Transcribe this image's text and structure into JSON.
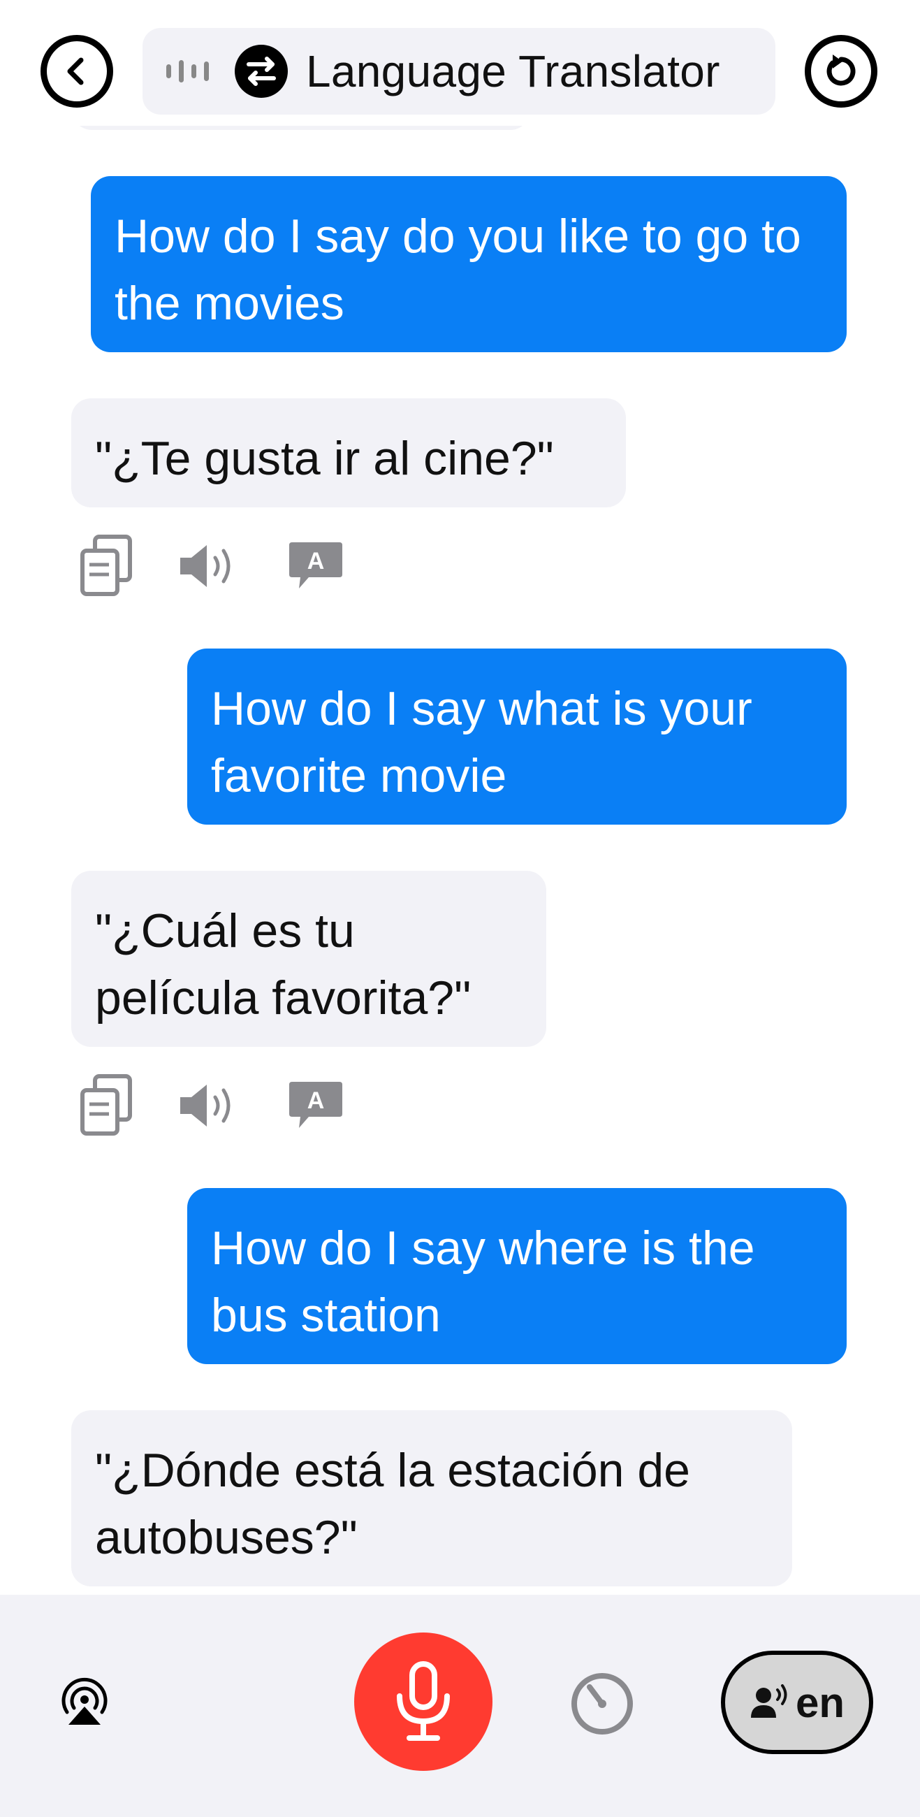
{
  "header": {
    "title": "Language Translator",
    "back_icon": "chevron-left-icon",
    "reset_icon": "refresh-icon"
  },
  "messages": [
    {
      "role": "user",
      "text": "How do I say do you like to go to the movies"
    },
    {
      "role": "assistant",
      "text": "\"¿Te gusta ir al cine?\""
    },
    {
      "role": "user",
      "text": "How do I say what is your favorite movie"
    },
    {
      "role": "assistant",
      "text": "\"¿Cuál es tu película favorita?\""
    },
    {
      "role": "user",
      "text": "How do I say where is the bus station"
    },
    {
      "role": "assistant",
      "text": "\"¿Dónde está la estación de autobuses?\""
    }
  ],
  "message_actions": {
    "copy_icon": "copy-icon",
    "speak_icon": "speaker-icon",
    "translate_label": "A"
  },
  "bottom_bar": {
    "language_code": "en",
    "mic_icon": "microphone-icon",
    "airplay_icon": "airplay-icon",
    "timer_icon": "timer-icon"
  },
  "colors": {
    "user_bubble": "#0a7ff5",
    "assistant_bubble": "#f2f2f7",
    "mic_button": "#ff3b30",
    "bar_background": "#f2f2f7"
  }
}
